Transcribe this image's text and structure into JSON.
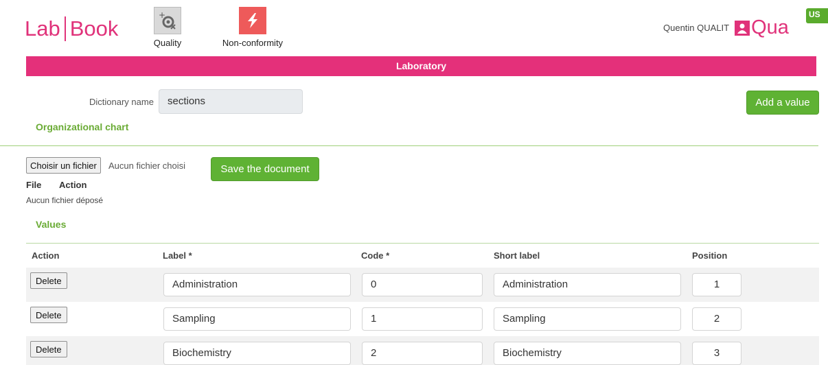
{
  "header": {
    "logo_left": "Lab",
    "logo_right": "Book",
    "modules": [
      {
        "label": "Quality",
        "icon": "quality-icon"
      },
      {
        "label": "Non-conformity",
        "icon": "lightning-icon"
      }
    ],
    "user_name": "Quentin QUALIT",
    "brand": "Qua",
    "language": "US"
  },
  "band": {
    "title": "Laboratory"
  },
  "dictionary": {
    "label": "Dictionary name",
    "value": "sections",
    "add_button": "Add a value"
  },
  "org_chart": {
    "title": "Organizational chart",
    "choose_file": "Choisir un fichier",
    "no_file_chosen": "Aucun fichier choisi",
    "save_button": "Save the document",
    "columns": [
      "File",
      "Action"
    ],
    "no_file_deposited": "Aucun fichier déposé"
  },
  "values": {
    "title": "Values",
    "columns": [
      "Action",
      "Label *",
      "Code *",
      "Short label",
      "Position"
    ],
    "delete_label": "Delete",
    "rows": [
      {
        "label": "Administration",
        "code": "0",
        "short_label": "Administration",
        "position": "1"
      },
      {
        "label": "Sampling",
        "code": "1",
        "short_label": "Sampling",
        "position": "2"
      },
      {
        "label": "Biochemistry",
        "code": "2",
        "short_label": "Biochemistry",
        "position": "3"
      }
    ]
  },
  "colors": {
    "accent_pink": "#e4307a",
    "accent_green": "#5fb234",
    "section_green": "#6aab35"
  }
}
